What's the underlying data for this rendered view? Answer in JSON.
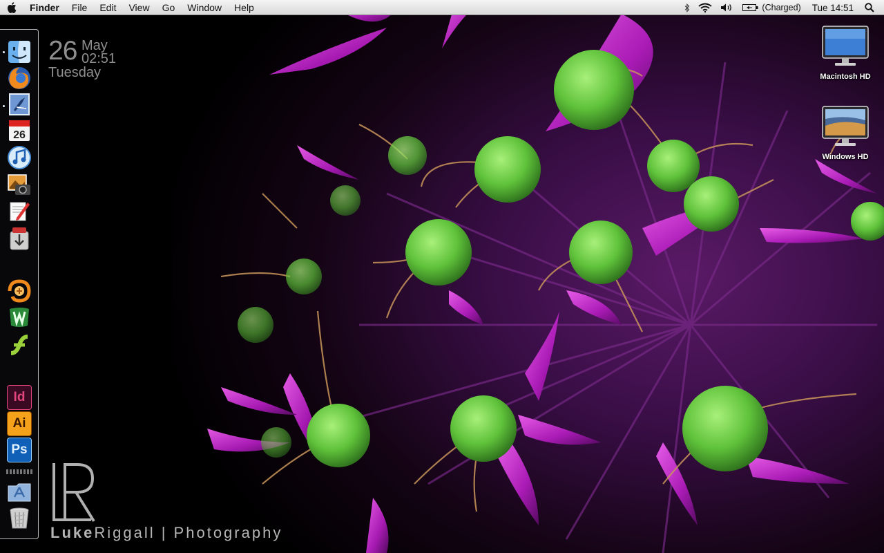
{
  "menubar": {
    "app_name": "Finder",
    "menus": [
      "File",
      "Edit",
      "View",
      "Go",
      "Window",
      "Help"
    ],
    "status": {
      "battery_text": "(Charged)",
      "clock": "Tue 14:51"
    },
    "icons": [
      "apple-icon",
      "bluetooth-icon",
      "wifi-icon",
      "volume-icon",
      "battery-icon",
      "spotlight-icon"
    ]
  },
  "clock_widget": {
    "day": "26",
    "month": "May",
    "time": "02:51",
    "weekday": "Tuesday"
  },
  "dock": {
    "items": [
      {
        "icon": "finder-icon",
        "running": true
      },
      {
        "icon": "firefox-icon",
        "running": false
      },
      {
        "icon": "mail-icon",
        "running": true
      },
      {
        "icon": "ical-icon",
        "running": false,
        "text": "26"
      },
      {
        "icon": "itunes-icon",
        "running": false
      },
      {
        "icon": "iphoto-icon",
        "running": false
      },
      {
        "icon": "textedit-icon",
        "running": false
      },
      {
        "icon": "installer-icon",
        "running": false
      },
      {
        "icon": "fireworks-icon",
        "running": false
      },
      {
        "icon": "dreamweaver-icon",
        "running": false
      },
      {
        "icon": "flash-icon",
        "running": false
      },
      {
        "icon": "indesign-icon",
        "running": false,
        "text": "Id"
      },
      {
        "icon": "illustrator-icon",
        "running": false,
        "text": "Ai"
      },
      {
        "icon": "photoshop-icon",
        "running": false,
        "text": "Ps"
      },
      {
        "icon": "applications-folder-icon",
        "running": false
      },
      {
        "icon": "trash-icon",
        "running": false
      }
    ]
  },
  "desktop_icons": [
    {
      "label": "Macintosh HD"
    },
    {
      "label": "Windows HD"
    }
  ],
  "watermark": {
    "logo_text": "LR",
    "text_bold": "Luke",
    "text_regular": "Riggall | Photography"
  },
  "colors": {
    "flower_magenta": "#c01ec8",
    "seed_green": "#5fc23a",
    "dock_border": "#dcdcdc",
    "clock_gray": "#8f8f8f"
  }
}
